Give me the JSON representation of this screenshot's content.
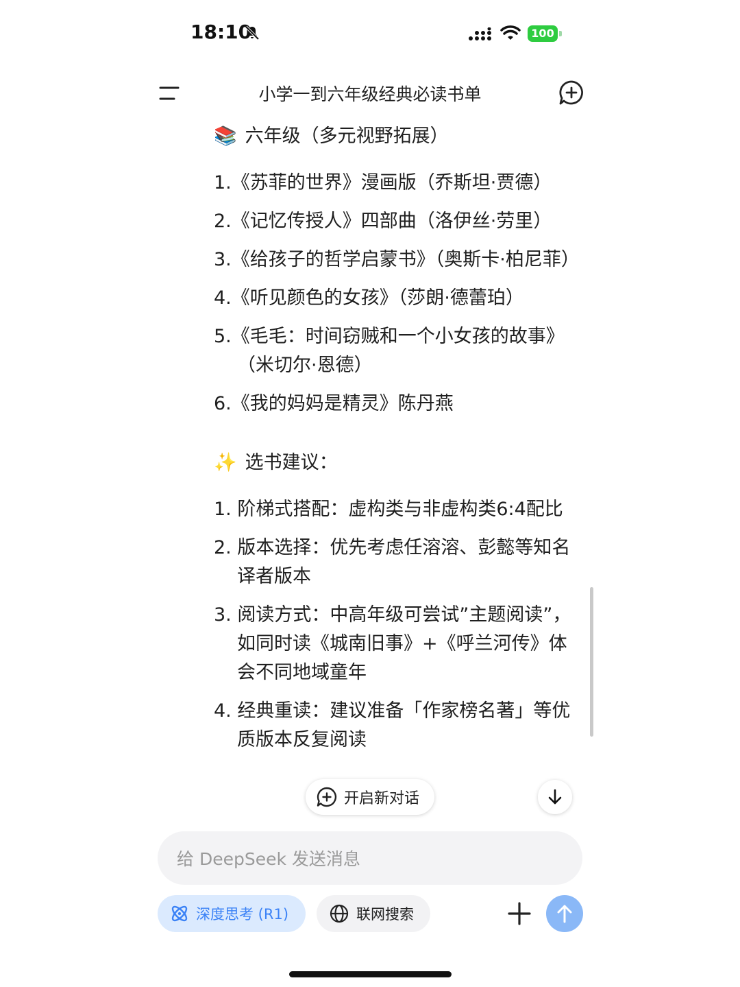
{
  "status_bar": {
    "time": "18:10",
    "battery": "100"
  },
  "header": {
    "title": "小学一到六年级经典必读书单"
  },
  "section_grade6": {
    "emoji": "📚",
    "heading": "六年级（多元视野拓展）",
    "items": [
      "1.《苏菲的世界》漫画版（乔斯坦·贾德）",
      "2.《记忆传授人》四部曲（洛伊丝·劳里）",
      "3.《给孩子的哲学启蒙书》（奥斯卡·柏尼菲）",
      "4.《听见颜色的女孩》（莎朗·德蕾珀）",
      "5.《毛毛：时间窃贼和一个小女孩的故事》（米切尔·恩德）",
      "6.《我的妈妈是精灵》陈丹燕"
    ]
  },
  "section_advice": {
    "emoji": "✨",
    "heading": "选书建议：",
    "items": [
      "1. 阶梯式搭配：虚构类与非虚构类6:4配比",
      "2. 版本选择：优先考虑任溶溶、彭懿等知名译者版本",
      "3. 阅读方式：中高年级可尝试”主题阅读”，如同时读《城南旧事》+《呼兰河传》体会不同地域童年",
      "4. 经典重读：建议准备「作家榜名著」等优质版本反复阅读"
    ]
  },
  "floating": {
    "new_chat_label": "开启新对话"
  },
  "composer": {
    "placeholder": "给 DeepSeek 发送消息",
    "deepthink_label": "深度思考 (R1)",
    "websearch_label": "联网搜索"
  },
  "colors": {
    "accent": "#3b82f6",
    "deepthink_bg": "#dbeafe",
    "send_bg": "#8ab8f7",
    "battery": "#2ecc40"
  }
}
